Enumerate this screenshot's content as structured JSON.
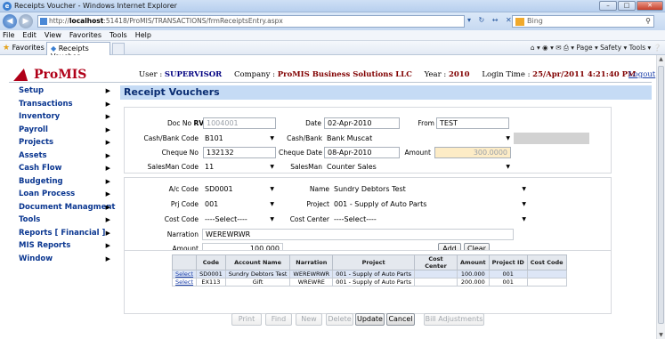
{
  "window": {
    "title": "Receipts Voucher - Windows Internet Explorer"
  },
  "browser": {
    "url_prefix": "http://",
    "url_host": "localhost",
    "url_path": ":51418/ProMIS/TRANSACTIONS/frmReceiptsEntry.aspx",
    "search_placeholder": "Bing",
    "menu": [
      "File",
      "Edit",
      "View",
      "Favorites",
      "Tools",
      "Help"
    ],
    "favorites_label": "Favorites",
    "tab_label": "Receipts Voucher",
    "commands": "Page ▾  Safety ▾  Tools ▾"
  },
  "app": {
    "logo": "ProMIS",
    "user_label": "User :",
    "user": "SUPERVISOR",
    "company_label": "Company :",
    "company": "ProMIS Business Solutions LLC",
    "year_label": "Year :",
    "year": "2010",
    "login_label": "Login Time :",
    "login_time": "25/Apr/2011 4:21:40 PM",
    "logout": "Logout"
  },
  "sidebar": [
    "Setup",
    "Transactions",
    "Inventory",
    "Payroll",
    "Projects",
    "Assets",
    "Cash Flow",
    "Budgeting",
    "Loan Process",
    "Document Managment",
    "Tools",
    "Reports [ Financial ]",
    "MIS Reports",
    "Window"
  ],
  "page_title": "Receipt Vouchers",
  "header": {
    "doc_no_label": "Doc No",
    "doc_prefix": "RVM",
    "doc_no": "1004001",
    "date_label": "Date",
    "date": "02-Apr-2010",
    "from_label": "From",
    "from": "TEST",
    "cash_bank_code_label": "Cash/Bank Code",
    "cash_bank_code": "B101",
    "cash_bank_label": "Cash/Bank",
    "cash_bank": "Bank Muscat",
    "cheque_no_label": "Cheque No",
    "cheque_no": "132132",
    "cheque_date_label": "Cheque Date",
    "cheque_date": "08-Apr-2010",
    "amount_label": "Amount",
    "amount": "300.0000",
    "salesman_code_label": "SalesMan Code",
    "salesman_code": "11",
    "salesman_label": "SalesMan",
    "salesman": "Counter Sales"
  },
  "line": {
    "ac_code_label": "A/c Code",
    "ac_code": "SD0001",
    "name_label": "Name",
    "name": "Sundry Debtors Test",
    "prj_code_label": "Prj Code",
    "prj_code": "001",
    "project_label": "Project",
    "project": "001 - Supply of Auto Parts",
    "cost_code_label": "Cost Code",
    "cost_code": "----Select----",
    "cost_center_label": "Cost Center",
    "cost_center": "----Select----",
    "narration_label": "Narration",
    "narration": "WEREWRWR",
    "amount_label": "Amount",
    "amount": "100.000",
    "add": "Add",
    "clear": "Clear"
  },
  "grid": {
    "columns": [
      "",
      "Code",
      "Account Name",
      "Narration",
      "Project",
      "Cost Center",
      "Amount",
      "Project ID",
      "Cost Code"
    ],
    "rows": [
      [
        "Select",
        "SD0001",
        "Sundry Debtors Test",
        "WEREWRWR",
        "001 - Supply of Auto Parts",
        "",
        "100.000",
        "001",
        ""
      ],
      [
        "Select",
        "EX113",
        "Gift",
        "WREWRE",
        "001 - Supply of Auto Parts",
        "",
        "200.000",
        "001",
        ""
      ]
    ]
  },
  "actions": {
    "print": "Print",
    "find": "Find",
    "new": "New",
    "delete": "Delete",
    "update": "Update",
    "cancel": "Cancel",
    "bill_adjustments": "Bill Adjustments"
  }
}
